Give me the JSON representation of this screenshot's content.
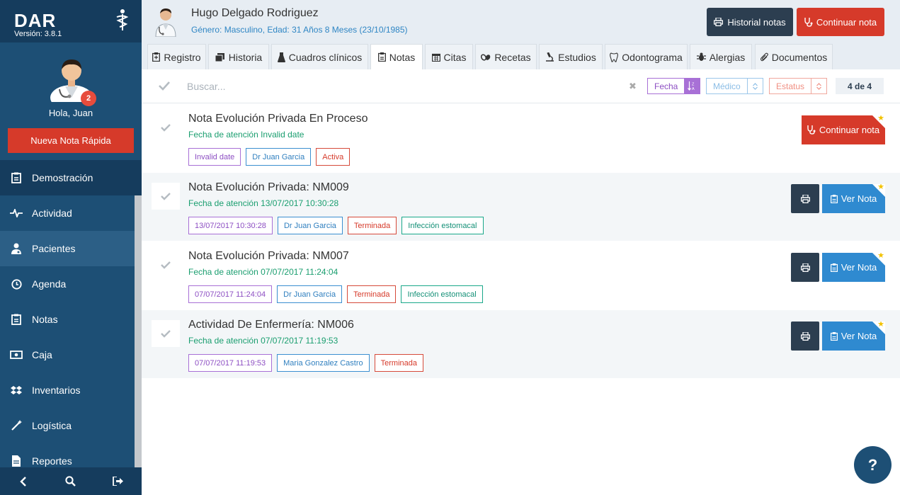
{
  "app": {
    "brand": "DAR",
    "version": "Versión: 3.8.1"
  },
  "sidebar": {
    "badge": "2",
    "greeting": "Hola, Juan",
    "quick_note": "Nueva Nota Rápida",
    "items": [
      {
        "label": "Demostración",
        "icon": "clipboard-icon"
      },
      {
        "label": "Actividad",
        "icon": "heartbeat-icon"
      },
      {
        "label": "Pacientes",
        "icon": "user-doctor-icon"
      },
      {
        "label": "Agenda",
        "icon": "clock-icon"
      },
      {
        "label": "Notas",
        "icon": "clipboard-icon"
      },
      {
        "label": "Caja",
        "icon": "money-icon"
      },
      {
        "label": "Inventarios",
        "icon": "dropbox-icon"
      },
      {
        "label": "Logística",
        "icon": "magic-wand-icon"
      },
      {
        "label": "Reportes",
        "icon": "file-icon"
      }
    ]
  },
  "patient": {
    "name": "Hugo Delgado Rodriguez",
    "info": "Género: Masculino, Edad: 31 Años 8 Meses (23/10/1985)"
  },
  "header": {
    "history_label": "Historial notas",
    "continue_label": "Continuar nota"
  },
  "tabs": [
    "Registro",
    "Historia",
    "Cuadros clínicos",
    "Notas",
    "Citas",
    "Recetas",
    "Estudios",
    "Odontograma",
    "Alergias",
    "Documentos"
  ],
  "search": {
    "placeholder": "Buscar...",
    "filters": {
      "date": "Fecha",
      "doctor": "Médico",
      "status": "Estatus"
    },
    "count": "4 de 4"
  },
  "notes": [
    {
      "title": "Nota Evolución Privada En Proceso",
      "date": "Fecha de atención Invalid date",
      "tags": [
        "Invalid date",
        "Dr Juan Garcia",
        "Activa"
      ],
      "action": "Continuar nota"
    },
    {
      "title": "Nota Evolución Privada: NM009",
      "date": "Fecha de atención 13/07/2017 10:30:28",
      "tags": [
        "13/07/2017 10:30:28",
        "Dr Juan Garcia",
        "Terminada",
        "Infección estomacal"
      ],
      "action": "Ver Nota"
    },
    {
      "title": "Nota Evolución Privada: NM007",
      "date": "Fecha de atención 07/07/2017 11:24:04",
      "tags": [
        "07/07/2017 11:24:04",
        "Dr Juan Garcia",
        "Terminada",
        "Infección estomacal"
      ],
      "action": "Ver Nota"
    },
    {
      "title": "Actividad De Enfermería: NM006",
      "date": "Fecha de atención 07/07/2017 11:19:53",
      "tags": [
        "07/07/2017 11:19:53",
        "Maria Gonzalez Castro",
        "Terminada"
      ],
      "action": "Ver Nota"
    }
  ],
  "help": "?",
  "colors": {
    "sidebar": "#1d4f75",
    "accent_red": "#d63a2a",
    "accent_blue": "#2f8ad0",
    "dark": "#2c3e50"
  }
}
